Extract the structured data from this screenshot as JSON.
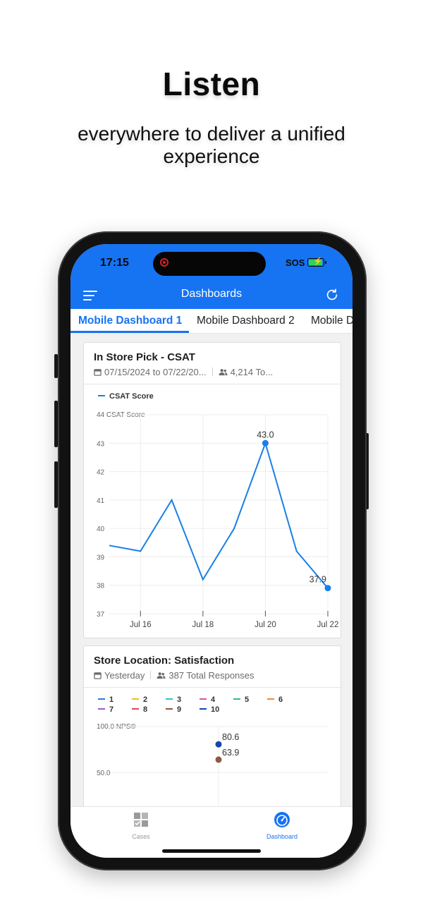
{
  "promo": {
    "headline": "Listen",
    "subline": "everywhere to deliver a unified experience"
  },
  "status_bar": {
    "time": "17:15",
    "carrier": "SOS"
  },
  "app_bar": {
    "title": "Dashboards",
    "menu_icon": "hamburger-menu-icon",
    "refresh_icon": "refresh-icon"
  },
  "tabs": [
    {
      "label": "Mobile Dashboard 1",
      "active": true
    },
    {
      "label": "Mobile Dashboard 2",
      "active": false
    },
    {
      "label": "Mobile D",
      "active": false
    }
  ],
  "widgets": [
    {
      "title": "In Store Pick - CSAT",
      "date_range": "07/15/2024 to 07/22/20...",
      "responses": "4,214 To...",
      "legend": "CSAT Score",
      "y_axis_title": "44 CSAT Score"
    },
    {
      "title": "Store Location: Satisfaction",
      "date_range": "Yesterday",
      "responses": "387 Total Responses",
      "y_axis_title": "100.0 NPS®"
    }
  ],
  "chart_data": [
    {
      "type": "line",
      "series": [
        {
          "name": "CSAT Score",
          "color": "#1a7fe8",
          "x": [
            "Jul 15",
            "Jul 16",
            "Jul 17",
            "Jul 18",
            "Jul 19",
            "Jul 20",
            "Jul 21",
            "Jul 22"
          ],
          "values": [
            39.4,
            39.2,
            41.0,
            38.2,
            40.0,
            43.0,
            39.2,
            37.9
          ]
        }
      ],
      "data_labels": [
        "43.0",
        "37.9"
      ],
      "xticks": [
        "Jul 16",
        "Jul 18",
        "Jul 20",
        "Jul 22"
      ],
      "yticks": [
        "37",
        "38",
        "39",
        "40",
        "41",
        "42",
        "43"
      ],
      "ylim": [
        37,
        44
      ],
      "grid": true
    },
    {
      "type": "scatter",
      "legend": [
        {
          "name": "1",
          "color": "#1a7fe8"
        },
        {
          "name": "2",
          "color": "#e8c21a"
        },
        {
          "name": "3",
          "color": "#2ec4c4"
        },
        {
          "name": "4",
          "color": "#e04ea6"
        },
        {
          "name": "5",
          "color": "#2fb98a"
        },
        {
          "name": "6",
          "color": "#f08a2a"
        },
        {
          "name": "7",
          "color": "#9b59d0"
        },
        {
          "name": "8",
          "color": "#e0455a"
        },
        {
          "name": "9",
          "color": "#8a5a44"
        },
        {
          "name": "10",
          "color": "#1346b0"
        }
      ],
      "points": [
        {
          "series": "10",
          "value": 80.6,
          "label": "80.6",
          "color": "#1346b0"
        },
        {
          "series": "9",
          "value": 63.9,
          "label": "63.9",
          "color": "#8a5a44"
        }
      ],
      "yticks": [
        "50.0"
      ],
      "ylim": [
        0,
        100
      ],
      "grid": true
    }
  ],
  "bottom_nav": [
    {
      "label": "Cases",
      "icon": "cases-icon",
      "active": false,
      "color": "#9a9a9a"
    },
    {
      "label": "Dashboard",
      "icon": "dashboard-gauge-icon",
      "active": true,
      "color": "#1673f2"
    }
  ]
}
